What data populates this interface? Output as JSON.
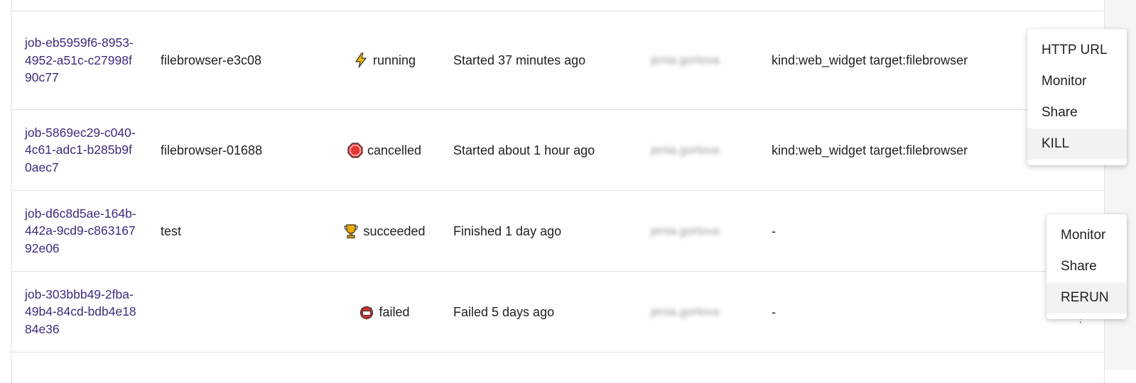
{
  "jobs": [
    {
      "id": "job-eb5959f6-8953-4952-a51c-c27998f90c77",
      "name": "filebrowser-e3c08",
      "status": "running",
      "status_icon": "lightning-icon",
      "time": "Started 37 minutes ago",
      "user": "jenia.gorlova",
      "tags": "kind:web_widget target:filebrowser"
    },
    {
      "id": "job-5869ec29-c040-4c61-adc1-b285b9f0aec7",
      "name": "filebrowser-01688",
      "status": "cancelled",
      "status_icon": "stop-sign-icon",
      "time": "Started about 1 hour ago",
      "user": "jenia.gorlova",
      "tags": "kind:web_widget target:filebrowser"
    },
    {
      "id": "job-d6c8d5ae-164b-442a-9cd9-c86316792e06",
      "name": "test",
      "status": "succeeded",
      "status_icon": "trophy-icon",
      "time": "Finished 1 day ago",
      "user": "jenia.gorlova",
      "tags": "-"
    },
    {
      "id": "job-303bbb49-2fba-49b4-84cd-bdb4e1884e36",
      "name": "",
      "status": "failed",
      "status_icon": "monster-face-icon",
      "time": "Failed 5 days ago",
      "user": "jenia.gorlova",
      "tags": "-"
    }
  ],
  "menu_running": [
    "HTTP URL",
    "Monitor",
    "Share",
    "KILL"
  ],
  "menu_finished": [
    "Monitor",
    "Share",
    "RERUN"
  ],
  "colors": {
    "link": "#3e2a7e",
    "running": "#f5b800",
    "cancelled": "#e53935",
    "succeeded": "#f2a900",
    "failed": "#d32f2f"
  }
}
